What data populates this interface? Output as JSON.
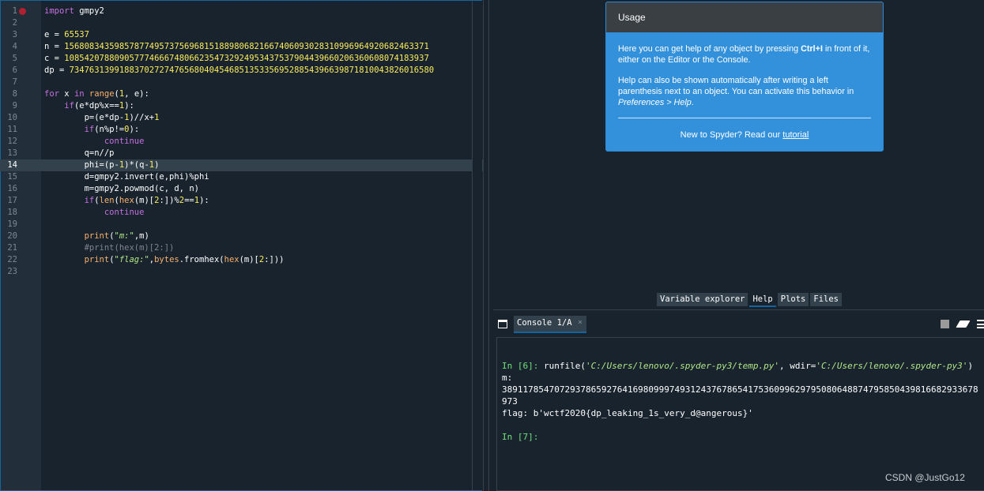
{
  "editor": {
    "breakpoint_line": 1,
    "current_line": 14,
    "lines": [
      {
        "n": "1",
        "text": "import gmpy2"
      },
      {
        "n": "2",
        "text": ""
      },
      {
        "n": "3",
        "text": "e = 65537"
      },
      {
        "n": "4",
        "text": "n = 1568083435985787749573756968151889806821667406093028310996964920682463371"
      },
      {
        "n": "5",
        "text": "c = 1085420788090577746667480662354732924953437537904439660206360608074183937"
      },
      {
        "n": "6",
        "text": "dp = 7347631399188370272747656804045468513533569528854396639871810043826016580"
      },
      {
        "n": "7",
        "text": ""
      },
      {
        "n": "8",
        "text": "for x in range(1, e):"
      },
      {
        "n": "9",
        "text": "    if(e*dp%x==1):"
      },
      {
        "n": "10",
        "text": "        p=(e*dp-1)//x+1"
      },
      {
        "n": "11",
        "text": "        if(n%p!=0):"
      },
      {
        "n": "12",
        "text": "            continue"
      },
      {
        "n": "13",
        "text": "        q=n//p"
      },
      {
        "n": "14",
        "text": "        phi=(p-1)*(q-1)"
      },
      {
        "n": "15",
        "text": "        d=gmpy2.invert(e,phi)%phi"
      },
      {
        "n": "16",
        "text": "        m=gmpy2.powmod(c, d, n)"
      },
      {
        "n": "17",
        "text": "        if(len(hex(m)[2:])%2==1):"
      },
      {
        "n": "18",
        "text": "            continue"
      },
      {
        "n": "19",
        "text": ""
      },
      {
        "n": "20",
        "text": "        print(\"m:\",m)"
      },
      {
        "n": "21",
        "text": "        #print(hex(m)[2:])"
      },
      {
        "n": "22",
        "text": "        print(\"flag:\",bytes.fromhex(hex(m)[2:]))"
      },
      {
        "n": "23",
        "text": ""
      }
    ]
  },
  "help": {
    "title": "Usage",
    "para1_pre": "Here you can get help of any object by pressing ",
    "para1_key": "Ctrl+I",
    "para1_post": " in front of it, either on the Editor or the Console.",
    "para2_pre": "Help can also be shown automatically after writing a left parenthesis next to an object. You can activate this behavior in ",
    "para2_em": "Preferences > Help",
    "para2_post": ".",
    "new_pre": "New to Spyder? Read our ",
    "new_link": "tutorial"
  },
  "pane_tabs": [
    {
      "label": "Variable explorer",
      "active": false
    },
    {
      "label": "Help",
      "active": true
    },
    {
      "label": "Plots",
      "active": false
    },
    {
      "label": "Files",
      "active": false
    }
  ],
  "console": {
    "tab_label": "Console 1/A",
    "close": "×",
    "in6_prompt": "In [6]:",
    "runfile_pre": " runfile(",
    "runfile_path1": "'C:/Users/lenovo/.spyder-py3/temp.py'",
    "runfile_mid": ", wdir=",
    "runfile_path2": "'C:/Users/lenovo/.spyder-py3'",
    "runfile_post": ")",
    "m_label": "m:",
    "m_value": "3891178547072937865927641698099974931243767865417536099629795080648874795850439816682933678973",
    "flag_line": "flag: b'wctf2020{dp_leaking_1s_very_d@angerous}'",
    "in7_prompt": "In [7]:"
  },
  "watermark": "CSDN @JustGo12"
}
